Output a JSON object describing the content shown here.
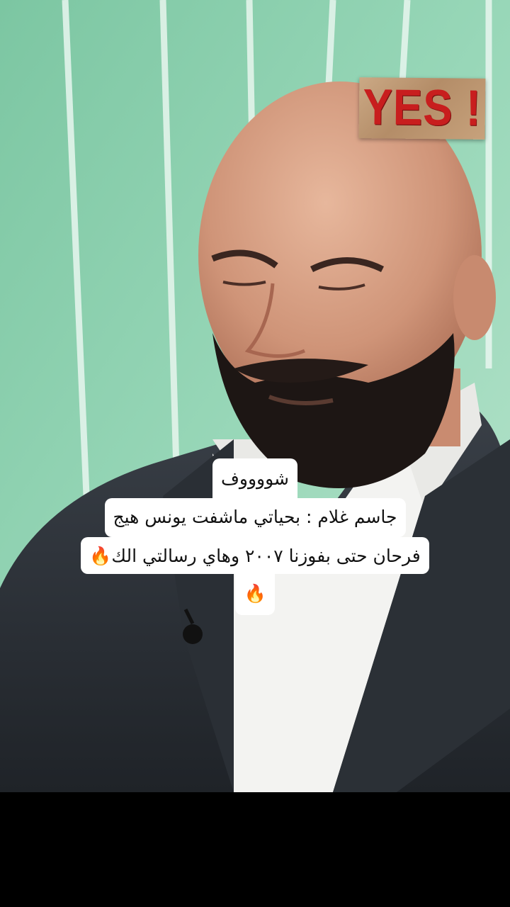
{
  "video": {
    "scene": "man-in-suit-studio",
    "background_color": "#8fcfb0"
  },
  "sticker": {
    "text": "YES !",
    "text_color": "#c81e1e"
  },
  "captions": {
    "line1": "شووووف",
    "line2": "جاسم غلام : بحياتي ماشفت يونس هيج",
    "line3": "فرحان حتى بفوزنا ٢٠٠٧ وهاي رسالتي الك🔥",
    "line4": "🔥"
  }
}
